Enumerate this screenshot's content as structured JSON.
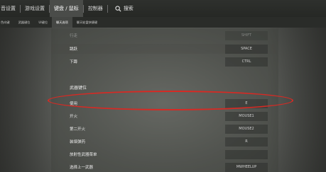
{
  "tabs": {
    "items": [
      {
        "label": "音设置",
        "active": false
      },
      {
        "label": "游戏设置",
        "active": false
      },
      {
        "label": "键盘 / 鼠标",
        "active": true
      },
      {
        "label": "控制器",
        "active": false
      }
    ],
    "search_label": "搜索"
  },
  "subtabs": {
    "items": [
      {
        "label": "色向键",
        "active": false
      },
      {
        "label": "武器键位",
        "active": false
      },
      {
        "label": "UI键位",
        "active": false
      },
      {
        "label": "聊天选项",
        "active": true
      },
      {
        "label": "聊天轮盘快捷键",
        "active": false
      }
    ]
  },
  "bindings_top": [
    {
      "label": "行走",
      "key": "SHIFT"
    },
    {
      "label": "跳跃",
      "key": "SPACE"
    },
    {
      "label": "下蹲",
      "key": "CTRL"
    }
  ],
  "section": {
    "title": "武器键位"
  },
  "bindings_weapon": [
    {
      "label": "使用",
      "key": "E"
    },
    {
      "label": "开火",
      "key": "MOUSE1"
    },
    {
      "label": "第二开火",
      "key": "MOUSE2"
    },
    {
      "label": "装填弹药",
      "key": "R"
    },
    {
      "label": "放射性武器菜单",
      "key": ""
    },
    {
      "label": "选择上一武器",
      "key": "MWHEELUP"
    }
  ],
  "colors": {
    "highlight": "#d62a24",
    "nav_bg": "#2e302d",
    "active_tab_bg": "#4a4c49"
  }
}
